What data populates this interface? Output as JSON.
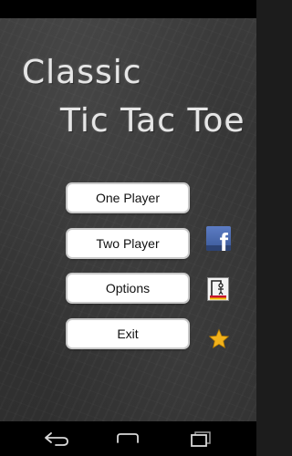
{
  "title": {
    "line1": "Classic",
    "line2": "Tic Tac Toe"
  },
  "menu": {
    "one_player": "One Player",
    "two_player": "Two Player",
    "options": "Options",
    "exit": "Exit"
  },
  "side_icons": [
    "facebook-icon",
    "hangman-icon",
    "star-icon"
  ],
  "nav_icons": [
    "back-icon",
    "home-icon",
    "recent-apps-icon"
  ],
  "colors": {
    "chalkboard": "#343434",
    "button_bg": "#ffffff",
    "facebook_blue": "#3b5998",
    "star_gold": "#f2b21b"
  }
}
